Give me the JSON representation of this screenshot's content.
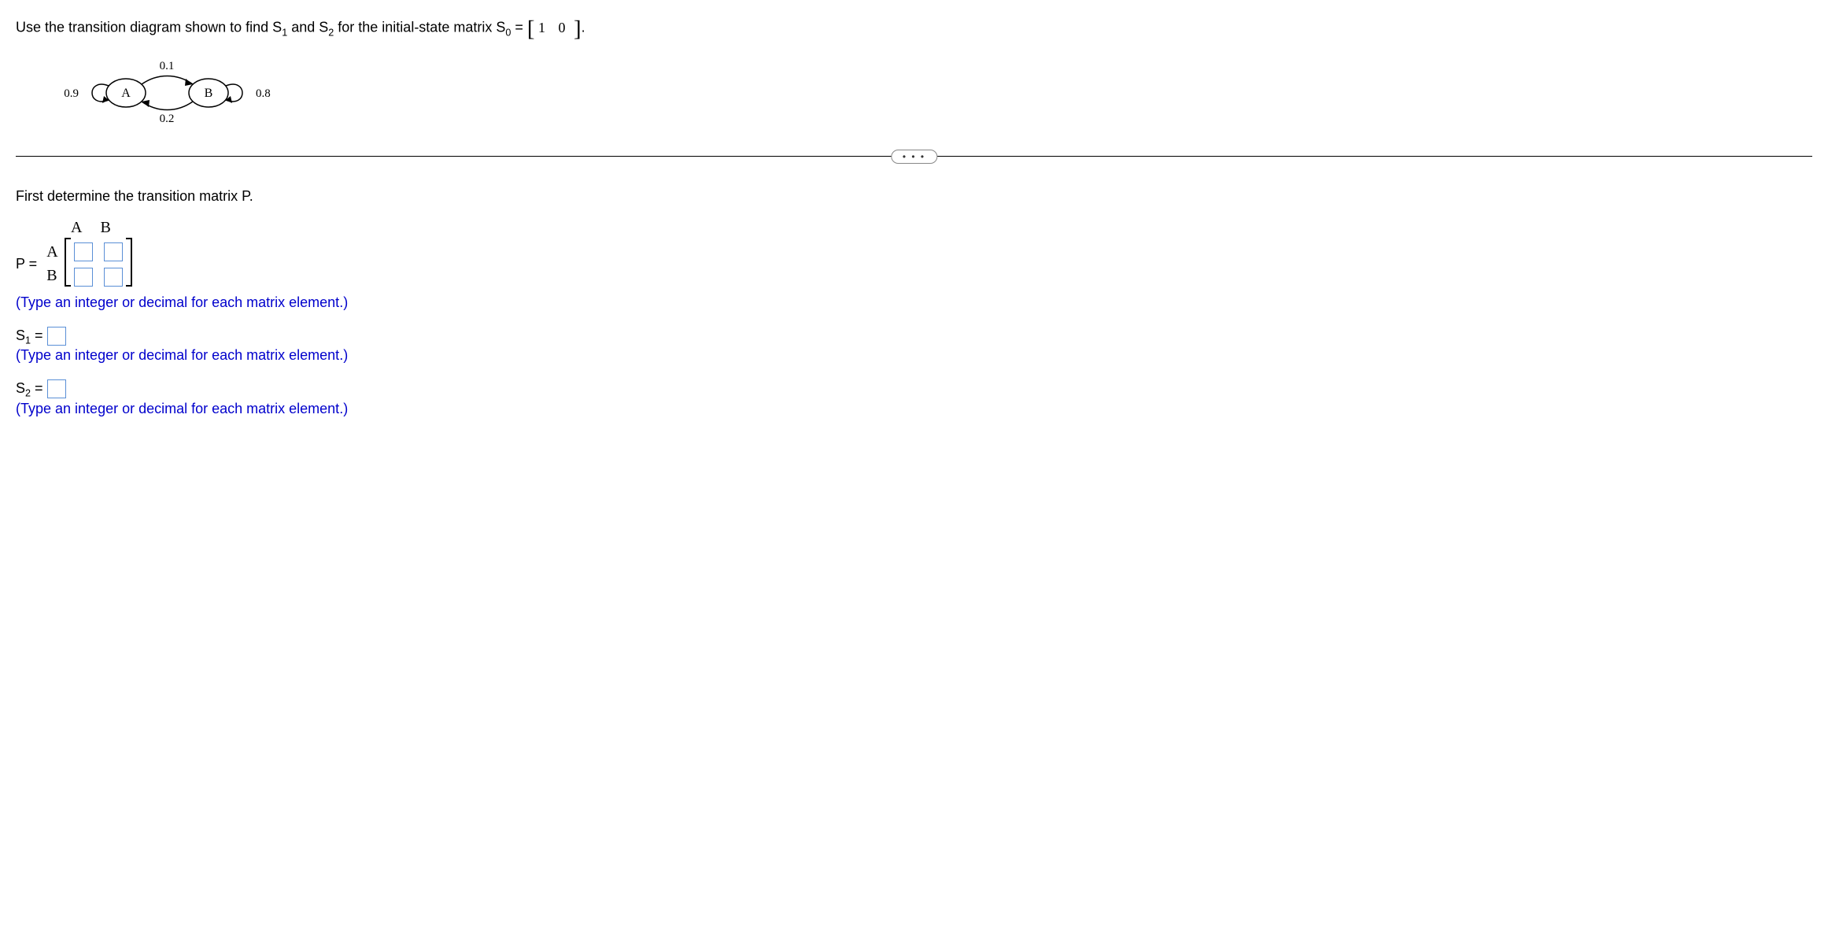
{
  "question": {
    "prefix": "Use the transition diagram shown to find S",
    "s1sub": "1",
    "mid1": " and S",
    "s2sub": "2",
    "mid2": " for the initial-state matrix S",
    "s0sub": "0",
    "eq": " = ",
    "matrix_vals": "1  0",
    "period": "."
  },
  "diagram": {
    "nodeA": "A",
    "nodeB": "B",
    "loopA": "0.9",
    "loopB": "0.8",
    "AtoB": "0.1",
    "BtoA": "0.2"
  },
  "dots": "• • •",
  "instruction1": "First determine the transition matrix P.",
  "pmatrix": {
    "colA": "A",
    "colB": "B",
    "rowA": "A",
    "rowB": "B",
    "label": "P ="
  },
  "hint": "(Type an integer or decimal for each matrix element.)",
  "s1": {
    "label_pre": "S",
    "label_sub": "1",
    "label_post": " ="
  },
  "s2": {
    "label_pre": "S",
    "label_sub": "2",
    "label_post": " ="
  }
}
